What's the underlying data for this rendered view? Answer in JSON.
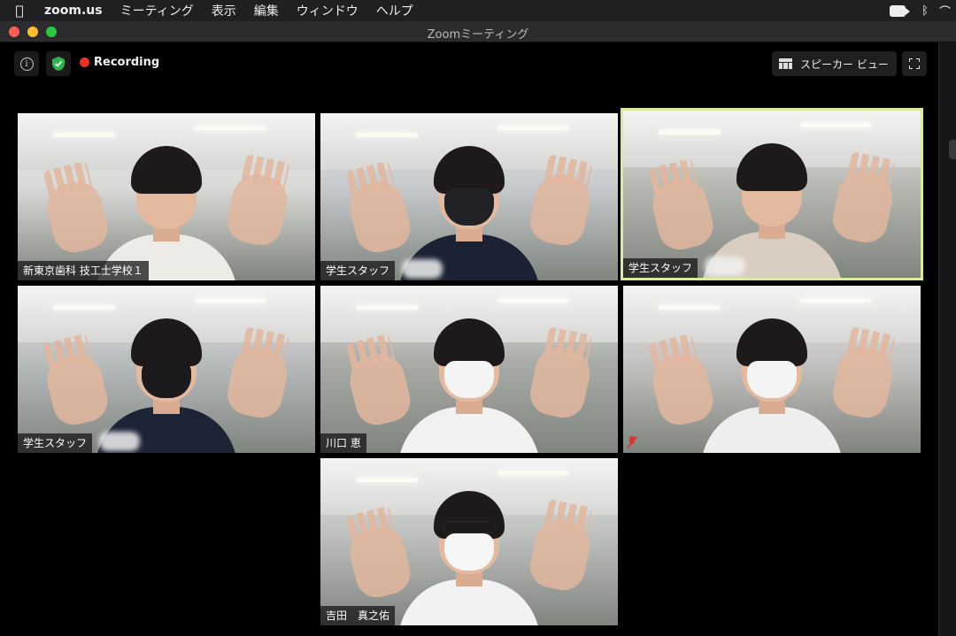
{
  "menubar": {
    "app_name": "zoom.us",
    "items": [
      "ミーティング",
      "表示",
      "編集",
      "ウィンドウ",
      "ヘルプ"
    ]
  },
  "window": {
    "title": "Zoomミーティング"
  },
  "toolbar": {
    "recording_label": "Recording",
    "view_label": "スピーカー ビュー"
  },
  "participants": [
    {
      "name": "新東京歯科 技工士学校１",
      "active": false,
      "mask_color": "",
      "shirt": "#ecebe6",
      "bg": "#d8d9d6"
    },
    {
      "name": "学生スタッフ",
      "active": false,
      "mask_color": "#222226",
      "shirt": "#1b2233",
      "bg": "#c6c9cc"
    },
    {
      "name": "学生スタッフ",
      "active": true,
      "mask_color": "",
      "shirt": "#d9cdbf",
      "bg": "#b7b8b2"
    },
    {
      "name": "学生スタッフ",
      "active": false,
      "mask_color": "#1b1b1d",
      "shirt": "#1d2436",
      "bg": "#b9bcbd"
    },
    {
      "name": "川口 恵",
      "active": false,
      "mask_color": "#f4f4f4",
      "shirt": "#f1f1f1",
      "bg": "#a9aca7"
    },
    {
      "name": "",
      "active": false,
      "mask_color": "#f4f4f4",
      "shirt": "#eeeeee",
      "bg": "#c5c3c1",
      "muted": true
    },
    {
      "name": "吉田　真之佑",
      "active": false,
      "mask_color": "#f6f6f6",
      "shirt": "#f2f2f2",
      "bg": "#bfc1bf",
      "glasses": true
    }
  ],
  "blurred_name_suffix": "°"
}
